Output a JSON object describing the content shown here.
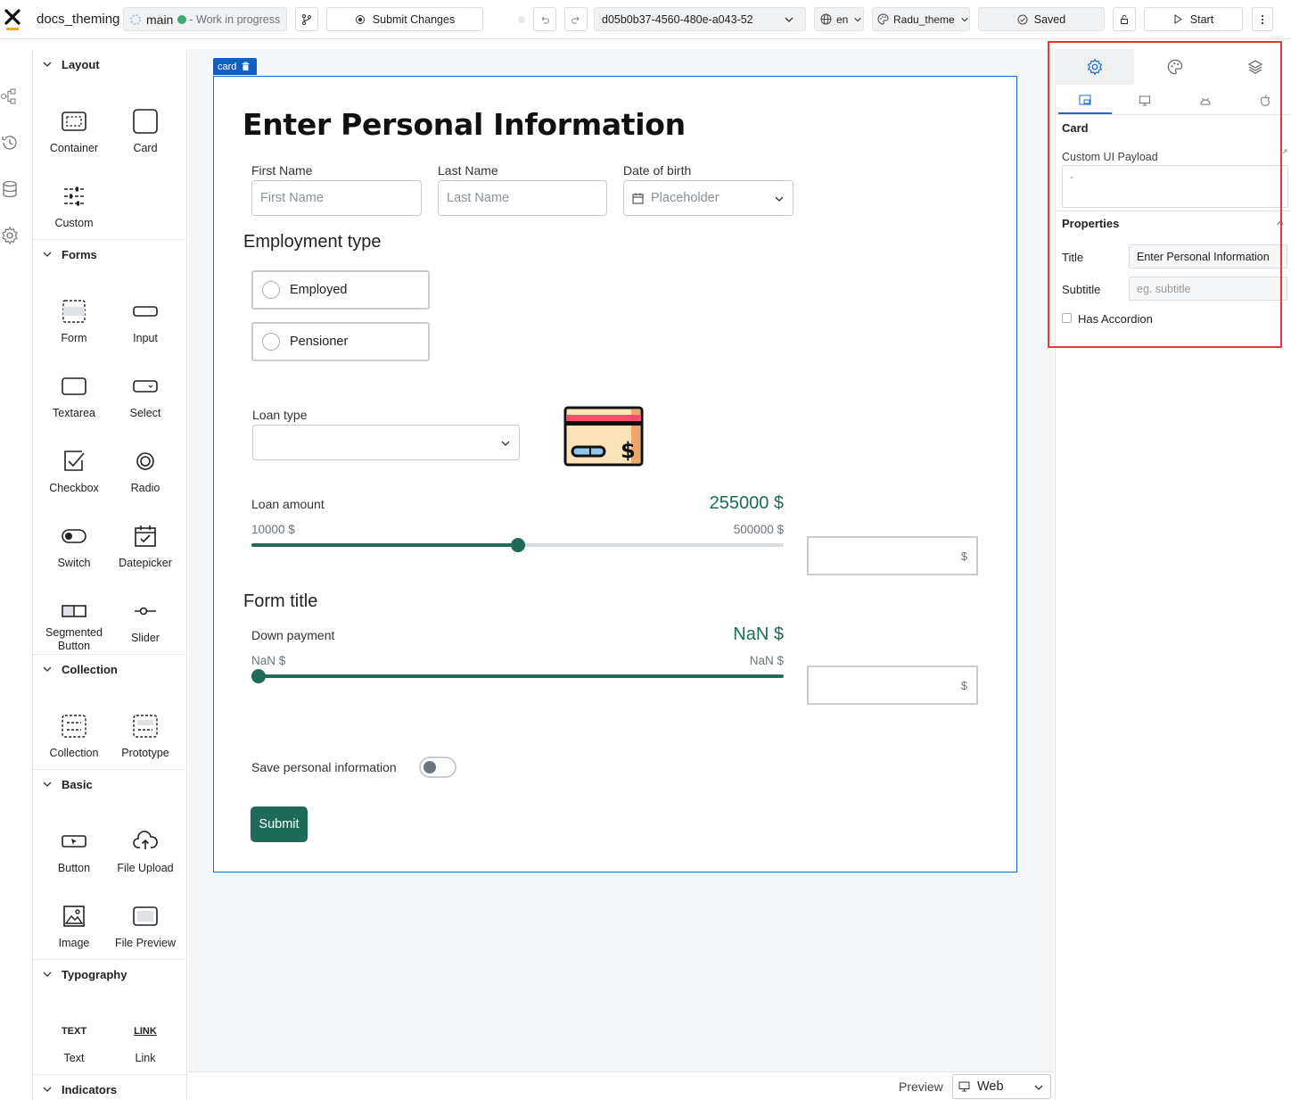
{
  "topbar": {
    "app_name": "docs_theming",
    "branch_name": "main",
    "branch_status": "- Work in progress",
    "submit_changes_label": "Submit Changes",
    "version_id": "d05b0b37-4560-480e-a043-52",
    "language": "en",
    "theme": "Radu_theme",
    "saved_label": "Saved",
    "start_label": "Start"
  },
  "palette": {
    "layout": {
      "title": "Layout",
      "items": [
        "Container",
        "Card",
        "Custom"
      ]
    },
    "forms": {
      "title": "Forms",
      "items": [
        "Form",
        "Input",
        "Textarea",
        "Select",
        "Checkbox",
        "Radio",
        "Switch",
        "Datepicker",
        "Segmented Button",
        "Slider"
      ]
    },
    "collection": {
      "title": "Collection",
      "items": [
        "Collection",
        "Prototype"
      ]
    },
    "basic": {
      "title": "Basic",
      "items": [
        "Button",
        "File Upload",
        "Image",
        "File Preview"
      ]
    },
    "typography": {
      "title": "Typography",
      "items": [
        "Text",
        "Link"
      ],
      "text_glyph": "TEXT",
      "link_glyph": "LINK"
    },
    "indicators": {
      "title": "Indicators"
    }
  },
  "canvas": {
    "card_tag": "card",
    "card_title": "Enter Personal Information",
    "first_name": {
      "label": "First Name",
      "placeholder": "First Name"
    },
    "last_name": {
      "label": "Last Name",
      "placeholder": "Last Name"
    },
    "dob": {
      "label": "Date of birth",
      "placeholder": "Placeholder"
    },
    "employment": {
      "title": "Employment type",
      "options": [
        "Employed",
        "Pensioner"
      ]
    },
    "loan_type": {
      "label": "Loan type",
      "value": ""
    },
    "loan_amount": {
      "label": "Loan amount",
      "value": "255000 $",
      "min": "10000 $",
      "max": "500000 $",
      "fill_fraction": 0.5,
      "suffix": "$"
    },
    "form_title": "Form title",
    "down_payment": {
      "label": "Down payment",
      "value": "NaN $",
      "min": "NaN $",
      "max": "NaN $",
      "suffix": "$"
    },
    "save_info": {
      "label": "Save personal information",
      "on": false
    },
    "submit_label": "Submit"
  },
  "bottombar": {
    "preview_label": "Preview",
    "preview_value": "Web"
  },
  "right_panel": {
    "section_card": "Card",
    "custom_payload_label": "Custom UI Payload",
    "custom_payload_value": "-",
    "properties_title": "Properties",
    "title_label": "Title",
    "title_value": "Enter Personal Information",
    "subtitle_label": "Subtitle",
    "subtitle_placeholder": "eg. subtitle",
    "accordion_label": "Has Accordion"
  },
  "colors": {
    "primary_green": "#1e6b5a",
    "selection_blue": "#1b6ac9",
    "highlight_red": "#e53935"
  }
}
